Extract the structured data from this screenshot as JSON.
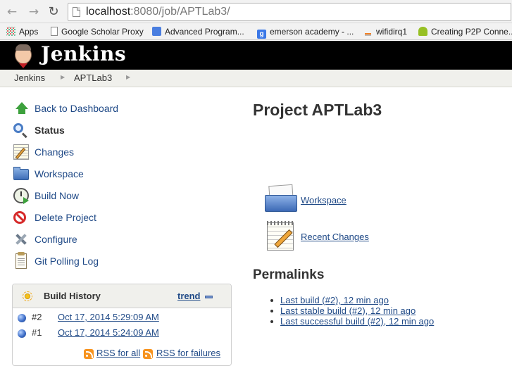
{
  "browser": {
    "url_host": "localhost",
    "url_path": ":8080/job/APTLab3/",
    "back_icon": "back-arrow-icon",
    "forward_icon": "forward-arrow-icon",
    "reload_icon": "reload-icon"
  },
  "bookmarks": [
    {
      "label": "Apps",
      "icon": "apps-grid-icon"
    },
    {
      "label": "Google Scholar Proxy",
      "icon": "page-icon"
    },
    {
      "label": "Advanced Program...",
      "icon": "google-docs-icon"
    },
    {
      "label": "emerson academy - ...",
      "icon": "google-icon"
    },
    {
      "label": "wifidirq1",
      "icon": "stackoverflow-icon"
    },
    {
      "label": "Creating P2P Conne...",
      "icon": "android-icon"
    }
  ],
  "header": {
    "logo_text": "Jenkins"
  },
  "breadcrumb": {
    "items": [
      "Jenkins",
      "APTLab3"
    ]
  },
  "sidebar": {
    "tasks": [
      {
        "label": "Back to Dashboard",
        "icon": "up-arrow-icon"
      },
      {
        "label": "Status",
        "icon": "magnifier-icon"
      },
      {
        "label": "Changes",
        "icon": "notepad-icon"
      },
      {
        "label": "Workspace",
        "icon": "folder-icon"
      },
      {
        "label": "Build Now",
        "icon": "clock-play-icon"
      },
      {
        "label": "Delete Project",
        "icon": "no-entry-icon"
      },
      {
        "label": "Configure",
        "icon": "tools-icon"
      },
      {
        "label": "Git Polling Log",
        "icon": "clipboard-icon"
      }
    ]
  },
  "build_history": {
    "title": "Build History",
    "trend_label": "trend",
    "builds": [
      {
        "number": "#2",
        "date": "Oct 17, 2014 5:29:09 AM",
        "status": "blue"
      },
      {
        "number": "#1",
        "date": "Oct 17, 2014 5:24:09 AM",
        "status": "blue"
      }
    ],
    "rss_all": "RSS for all",
    "rss_failures": "RSS for failures"
  },
  "main": {
    "title": "Project APTLab3",
    "workspace_link": "Workspace",
    "recent_changes_link": "Recent Changes",
    "permalinks_title": "Permalinks",
    "permalinks": [
      "Last build (#2), 12 min ago",
      "Last stable build (#2), 12 min ago",
      "Last successful build (#2), 12 min ago"
    ]
  },
  "colors": {
    "link": "#204a87",
    "header_bg": "#000000",
    "breadcrumb_bg": "#f0f0ec"
  }
}
